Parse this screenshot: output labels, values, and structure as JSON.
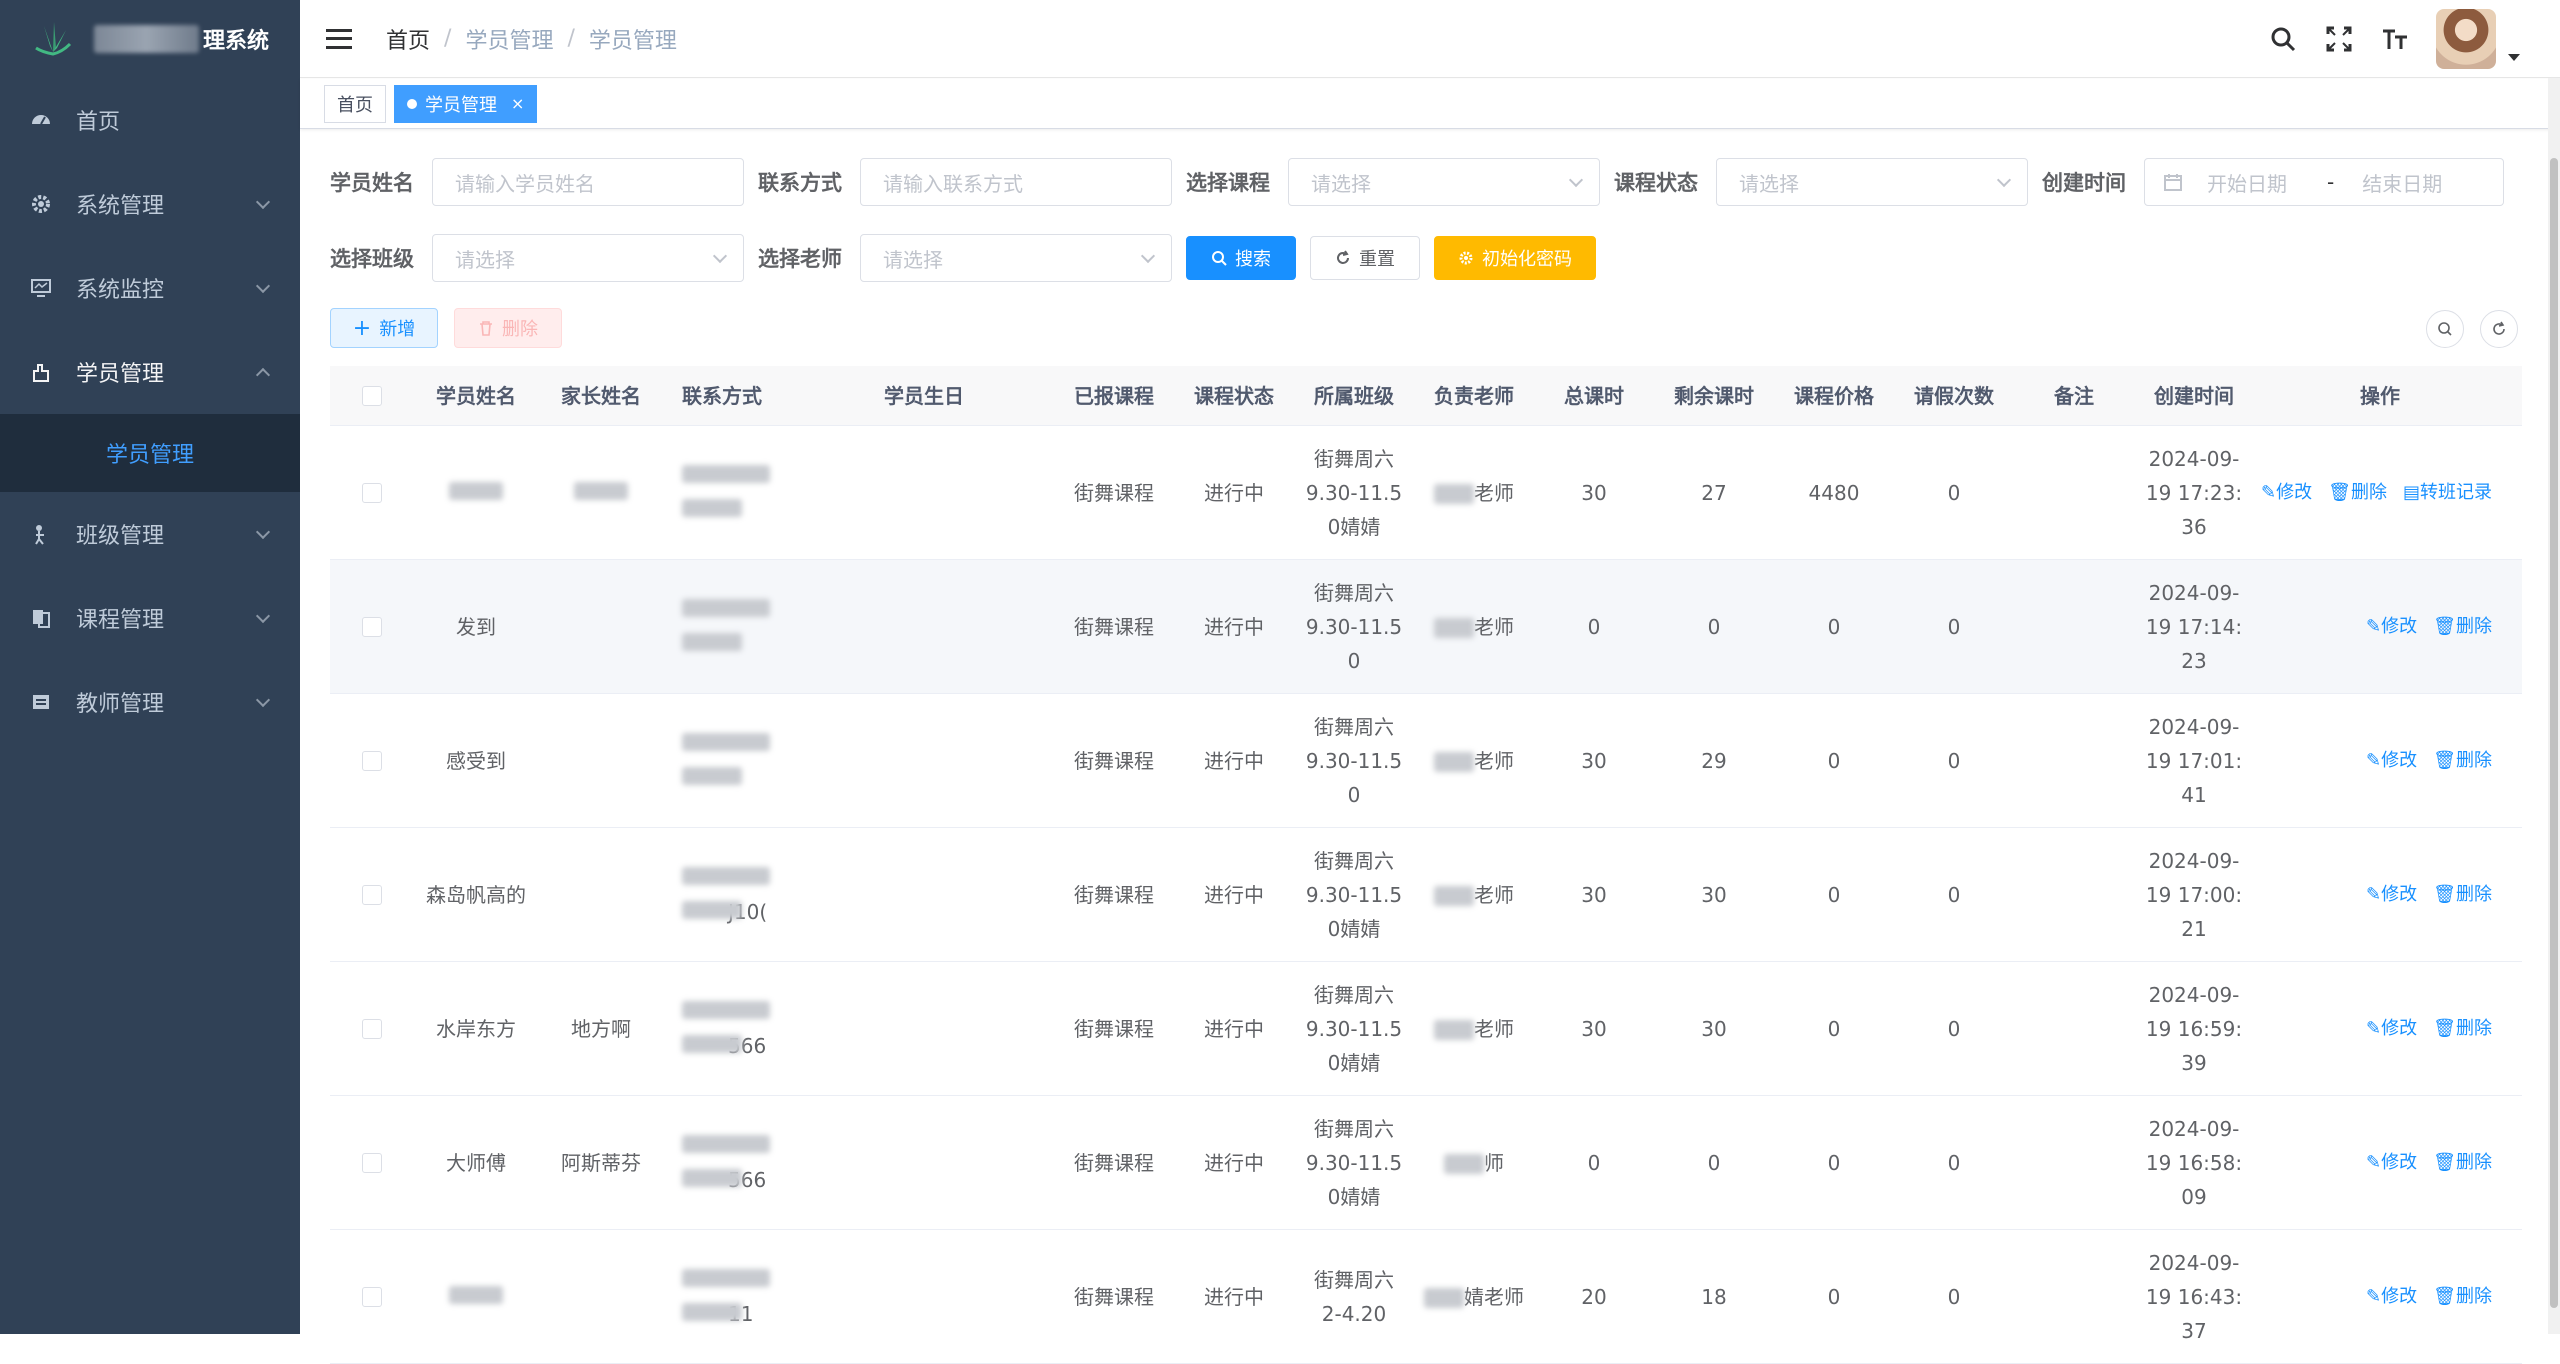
{
  "app": {
    "title_suffix": "理系统"
  },
  "sidebar": {
    "items": [
      {
        "label": "首页",
        "icon": "dashboard-icon"
      },
      {
        "label": "系统管理",
        "icon": "gear-icon"
      },
      {
        "label": "系统监控",
        "icon": "monitor-icon"
      },
      {
        "label": "学员管理",
        "icon": "student-icon"
      },
      {
        "label": "班级管理",
        "icon": "class-icon"
      },
      {
        "label": "课程管理",
        "icon": "course-icon"
      },
      {
        "label": "教师管理",
        "icon": "teacher-icon"
      }
    ],
    "submenu": {
      "label": "学员管理"
    }
  },
  "header": {
    "breadcrumb": [
      "首页",
      "学员管理",
      "学员管理"
    ],
    "separator": "/"
  },
  "tags": {
    "home": "首页",
    "active": "学员管理",
    "close": "×"
  },
  "filters": {
    "student_name": {
      "label": "学员姓名",
      "placeholder": "请输入学员姓名"
    },
    "contact": {
      "label": "联系方式",
      "placeholder": "请输入联系方式"
    },
    "course": {
      "label": "选择课程",
      "placeholder": "请选择"
    },
    "course_status": {
      "label": "课程状态",
      "placeholder": "请选择"
    },
    "created_time": {
      "label": "创建时间",
      "start": "开始日期",
      "dash": "-",
      "end": "结束日期"
    },
    "class": {
      "label": "选择班级",
      "placeholder": "请选择"
    },
    "teacher": {
      "label": "选择老师",
      "placeholder": "请选择"
    }
  },
  "buttons": {
    "search": "搜索",
    "reset": "重置",
    "init_password": "初始化密码",
    "add": "新增",
    "delete": "删除"
  },
  "table": {
    "headers": [
      "学员姓名",
      "家长姓名",
      "联系方式",
      "学员生日",
      "已报课程",
      "课程状态",
      "所属班级",
      "负责老师",
      "总课时",
      "剩余课时",
      "课程价格",
      "请假次数",
      "备注",
      "创建时间",
      "操作"
    ],
    "ops": {
      "edit": "修改",
      "delete": "删除",
      "transfer": "转班记录"
    },
    "rows": [
      {
        "name": "",
        "parent": "",
        "phone_tail": "",
        "course": "街舞课程",
        "status": "进行中",
        "class_lines": [
          "街舞周六",
          "9.30-11.5",
          "0婧婧"
        ],
        "teacher_suffix": "老师",
        "total": "30",
        "remain": "27",
        "price": "4480",
        "leave": "0",
        "created_lines": [
          "2024-09-",
          "19 17:23:",
          "36"
        ],
        "has_transfer": true
      },
      {
        "name": "发到",
        "parent": "",
        "phone_tail": "",
        "course": "街舞课程",
        "status": "进行中",
        "class_lines": [
          "街舞周六",
          "9.30-11.5",
          "0"
        ],
        "teacher_suffix": "老师",
        "total": "0",
        "remain": "0",
        "price": "0",
        "leave": "0",
        "created_lines": [
          "2024-09-",
          "19 17:14:",
          "23"
        ],
        "has_transfer": false
      },
      {
        "name": "感受到",
        "parent": "",
        "phone_tail": "",
        "course": "街舞课程",
        "status": "进行中",
        "class_lines": [
          "街舞周六",
          "9.30-11.5",
          "0"
        ],
        "teacher_suffix": "老师",
        "total": "30",
        "remain": "29",
        "price": "0",
        "leave": "0",
        "created_lines": [
          "2024-09-",
          "19 17:01:",
          "41"
        ],
        "has_transfer": false
      },
      {
        "name": "森岛帆高的",
        "parent": "",
        "phone_tail": "J10(",
        "course": "街舞课程",
        "status": "进行中",
        "class_lines": [
          "街舞周六",
          "9.30-11.5",
          "0婧婧"
        ],
        "teacher_suffix": "老师",
        "total": "30",
        "remain": "30",
        "price": "0",
        "leave": "0",
        "created_lines": [
          "2024-09-",
          "19 17:00:",
          "21"
        ],
        "has_transfer": false
      },
      {
        "name": "水岸东方",
        "parent": "地方啊",
        "phone_tail": "566",
        "course": "街舞课程",
        "status": "进行中",
        "class_lines": [
          "街舞周六",
          "9.30-11.5",
          "0婧婧"
        ],
        "teacher_suffix": "老师",
        "total": "30",
        "remain": "30",
        "price": "0",
        "leave": "0",
        "created_lines": [
          "2024-09-",
          "19 16:59:",
          "39"
        ],
        "has_transfer": false
      },
      {
        "name": "大师傅",
        "parent": "阿斯蒂芬",
        "phone_tail": "566",
        "course": "街舞课程",
        "status": "进行中",
        "class_lines": [
          "街舞周六",
          "9.30-11.5",
          "0婧婧"
        ],
        "teacher_suffix": "师",
        "total": "0",
        "remain": "0",
        "price": "0",
        "leave": "0",
        "created_lines": [
          "2024-09-",
          "19 16:58:",
          "09"
        ],
        "has_transfer": false
      },
      {
        "name": "",
        "parent": "",
        "phone_tail": "11",
        "course": "街舞课程",
        "status": "进行中",
        "class_lines": [
          "街舞周六",
          "2-4.20",
          ""
        ],
        "teacher_suffix": "婧老师",
        "total": "20",
        "remain": "18",
        "price": "0",
        "leave": "0",
        "created_lines": [
          "2024-09-",
          "19 16:43:",
          "37"
        ],
        "has_transfer": false
      }
    ]
  },
  "colors": {
    "sidebar_bg": "#304156",
    "primary": "#1890ff",
    "warning": "#ffba00"
  }
}
